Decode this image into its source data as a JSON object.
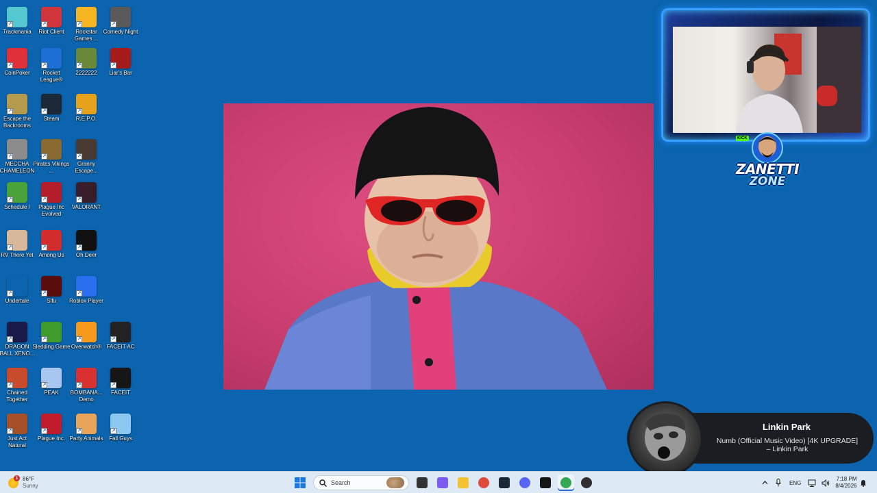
{
  "desktop": {
    "icons": [
      {
        "label": "Trackmania",
        "icon": "trackmania-icon",
        "color": "#55c7d1"
      },
      {
        "label": "Riot Client",
        "icon": "riot-client-icon",
        "color": "#d1363c"
      },
      {
        "label": "Rockstar Games ...",
        "icon": "rockstar-icon",
        "color": "#f5b622"
      },
      {
        "label": "Comedy Night",
        "icon": "microphone-icon",
        "color": "#5a5a5a"
      },
      {
        "label": "CoinPoker",
        "icon": "coinpoker-icon",
        "color": "#e0303a"
      },
      {
        "label": "Rocket League®",
        "icon": "rocket-league-icon",
        "color": "#1d6fd6"
      },
      {
        "label": "2222222",
        "icon": "game-icon",
        "color": "#6a8a3a"
      },
      {
        "label": "Liar's Bar",
        "icon": "liars-bar-icon",
        "color": "#a51b1b"
      },
      {
        "label": "Escape the Backrooms",
        "icon": "backrooms-icon",
        "color": "#b59b4d"
      },
      {
        "label": "Steam",
        "icon": "steam-icon",
        "color": "#1b2838"
      },
      {
        "label": "R.E.P.O.",
        "icon": "repo-icon",
        "color": "#e6a21a"
      },
      {
        "label": "MECCHA CHAMELEON",
        "icon": "chameleon-icon",
        "color": "#8c8c8c"
      },
      {
        "label": "Pirates Vikings ...",
        "icon": "pirates-icon",
        "color": "#8a6a30"
      },
      {
        "label": "Granny Escape...",
        "icon": "granny-icon",
        "color": "#4a3b32"
      },
      {
        "label": "Schedule I",
        "icon": "schedule-icon",
        "color": "#4aa33a"
      },
      {
        "label": "Plague Inc Evolved",
        "icon": "biohazard-icon",
        "color": "#b41d2a"
      },
      {
        "label": "VALORANT",
        "icon": "valorant-icon",
        "color": "#3a1d2a"
      },
      {
        "label": "RV There Yet",
        "icon": "rv-icon",
        "color": "#d8b89a"
      },
      {
        "label": "Among Us",
        "icon": "among-us-icon",
        "color": "#d12d2d"
      },
      {
        "label": "Oh Deer",
        "icon": "deer-icon",
        "color": "#111111"
      },
      {
        "label": "Undertale",
        "icon": "heart-icon",
        "color": "#0b64ad"
      },
      {
        "label": "Sifu",
        "icon": "sifu-icon",
        "color": "#5a0d0d"
      },
      {
        "label": "Roblox Player",
        "icon": "roblox-icon",
        "color": "#2a6ff0"
      },
      {
        "label": "DRAGON BALL XENO...",
        "icon": "dragonball-icon",
        "color": "#1a1a4a"
      },
      {
        "label": "Sledding Game",
        "icon": "frog-icon",
        "color": "#3f9b2c"
      },
      {
        "label": "Overwatch®",
        "icon": "overwatch-icon",
        "color": "#f79a1c"
      },
      {
        "label": "FACEIT AC",
        "icon": "faceit-ac-icon",
        "color": "#222222"
      },
      {
        "label": "Chained Together",
        "icon": "chained-icon",
        "color": "#c84c2c"
      },
      {
        "label": "PEAK",
        "icon": "mountain-icon",
        "color": "#a7c7f0"
      },
      {
        "label": "BOMBANA... Demo",
        "icon": "bombana-icon",
        "color": "#d93030"
      },
      {
        "label": "FACEIT",
        "icon": "faceit-icon",
        "color": "#161616"
      },
      {
        "label": "Just Act Natural",
        "icon": "jan-icon",
        "color": "#a6502a"
      },
      {
        "label": "Plague Inc.",
        "icon": "biohazard-icon",
        "color": "#c01c2b"
      },
      {
        "label": "Party Animals",
        "icon": "dog-icon",
        "color": "#e9a45a"
      },
      {
        "label": "Fall Guys",
        "icon": "fall-guys-icon",
        "color": "#8cc8f0"
      }
    ]
  },
  "overlay": {
    "brand_line1": "ZANETTI",
    "brand_line2": "ZONE",
    "kick_label": "KICK"
  },
  "now_playing": {
    "artist": "Linkin Park",
    "track": "Numb (Official Music Video) [4K UPGRADE] – Linkin Park"
  },
  "taskbar": {
    "weather": {
      "temp": "86°F",
      "condition": "Sunny",
      "badge": "1"
    },
    "search_placeholder": "Search",
    "apps": [
      {
        "name": "windows-start-icon",
        "color": "#1f7ae0"
      },
      {
        "name": "task-view-icon",
        "color": "#333333"
      },
      {
        "name": "copilot-icon",
        "color": "#7a5cf0"
      },
      {
        "name": "file-explorer-icon",
        "color": "#f2c230"
      },
      {
        "name": "chrome-icon",
        "color": "#e04a3a"
      },
      {
        "name": "steam-icon",
        "color": "#1b2838"
      },
      {
        "name": "discord-icon",
        "color": "#5865f2"
      },
      {
        "name": "faceit-icon",
        "color": "#161616"
      },
      {
        "name": "chrome-icon",
        "color": "#34a853"
      },
      {
        "name": "obs-icon",
        "color": "#302e31"
      }
    ],
    "language": "ENG",
    "time": "7:18 PM",
    "date": "8/4/2026"
  }
}
